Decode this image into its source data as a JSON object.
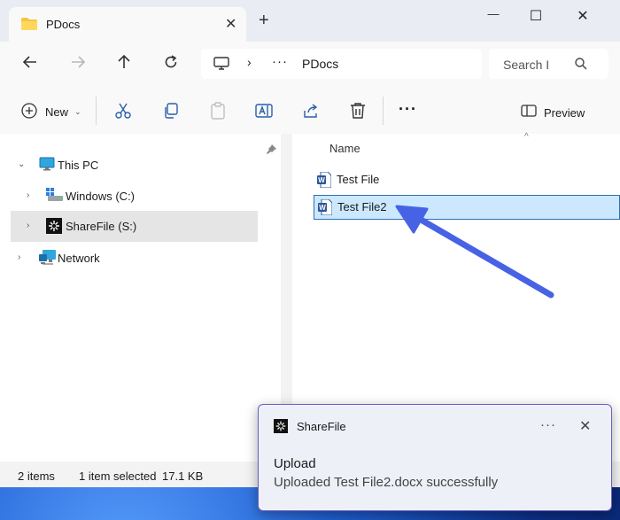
{
  "window": {
    "tab_title": "PDocs",
    "tab_close": "✕",
    "new_tab": "+",
    "controls": {
      "minimize": "—",
      "maximize": "☐",
      "close": "✕"
    }
  },
  "address_bar": {
    "chevron": "›",
    "overflow": "···",
    "crumb": "PDocs"
  },
  "search": {
    "placeholder": "Search I"
  },
  "toolbar": {
    "new_label": "New",
    "new_chevron": "⌄",
    "more": "···",
    "preview_label": "Preview"
  },
  "nav_pane": {
    "pin": "📌",
    "items": [
      {
        "label": "This PC",
        "expander": "⌄",
        "icon": "monitor-icon"
      },
      {
        "label": "Windows (C:)",
        "expander": "›",
        "icon": "windows-drive-icon"
      },
      {
        "label": "ShareFile (S:)",
        "expander": "›",
        "icon": "sharefile-drive-icon"
      },
      {
        "label": "Network",
        "expander": "›",
        "icon": "network-icon"
      }
    ]
  },
  "file_pane": {
    "column_name": "Name",
    "sort_indicator": "^",
    "files": [
      {
        "name": "Test File",
        "icon": "word-doc-icon"
      },
      {
        "name": "Test File2",
        "icon": "word-doc-icon"
      }
    ]
  },
  "status_bar": {
    "item_count": "2 items",
    "selection": "1 item selected",
    "size": "17.1 KB"
  },
  "toast": {
    "app_name": "ShareFile",
    "more": "···",
    "close": "✕",
    "title": "Upload",
    "message": "Uploaded Test File2.docx successfully"
  },
  "colors": {
    "accent": "#4763e4",
    "selection_bg": "#cce8ff",
    "selection_border": "#2f6fb0",
    "toast_border": "#6a5fc7"
  }
}
